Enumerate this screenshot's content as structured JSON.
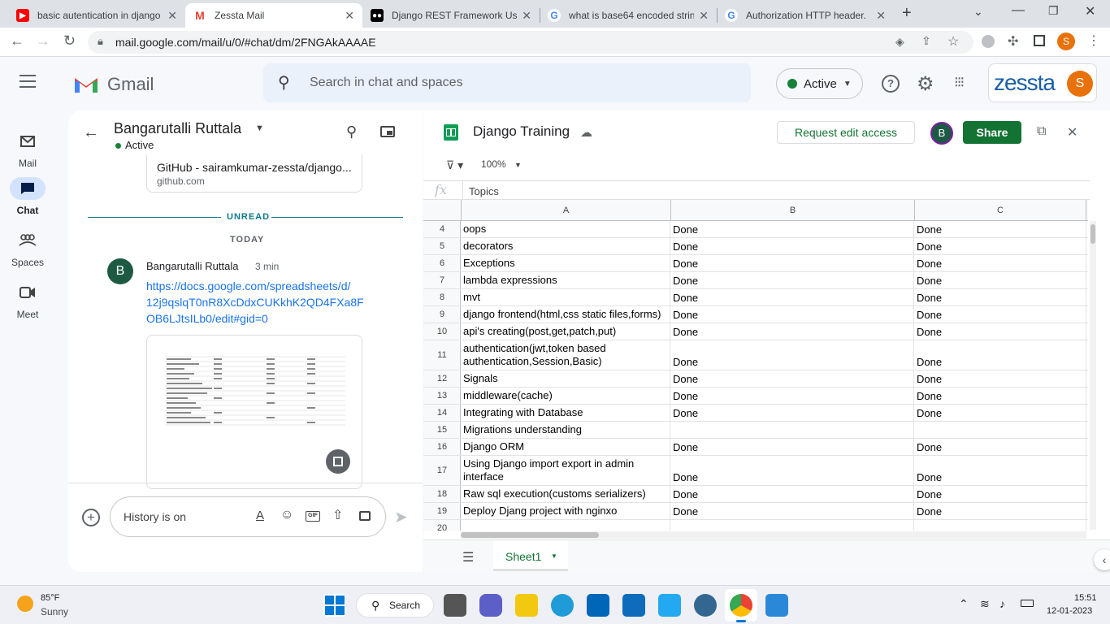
{
  "browser": {
    "tabs": [
      {
        "title": "basic autentication in django",
        "icon": "youtube-icon",
        "color": "#ff0000"
      },
      {
        "title": "Zessta Mail",
        "icon": "gmail-icon",
        "color": "#ea4335"
      },
      {
        "title": "Django REST Framework Use",
        "icon": "medium-icon",
        "color": "#000000"
      },
      {
        "title": "what is base64 encoded strin",
        "icon": "google-icon",
        "color": "#4285f4"
      },
      {
        "title": "Authorization HTTP header.",
        "icon": "google-icon",
        "color": "#4285f4"
      }
    ],
    "url": "mail.google.com/mail/u/0/#chat/dm/2FNGAkAAAAE",
    "profile_initial": "S"
  },
  "gmail": {
    "app_name": "Gmail",
    "search_placeholder": "Search in chat and spaces",
    "status": "Active",
    "brand": "zessta",
    "avatar_initial": "S",
    "nav": [
      {
        "label": "Mail",
        "icon": "mail-icon"
      },
      {
        "label": "Chat",
        "icon": "chat-icon"
      },
      {
        "label": "Spaces",
        "icon": "spaces-icon"
      },
      {
        "label": "Meet",
        "icon": "meet-icon"
      }
    ]
  },
  "chat": {
    "contact_name": "Bangarutalli Ruttala",
    "contact_status": "Active",
    "link_card": {
      "title": "GitHub - sairamkumar-zessta/django...",
      "domain": "github.com"
    },
    "unread_label": "UNREAD",
    "day_label": "TODAY",
    "message": {
      "avatar": "B",
      "sender": "Bangarutalli Ruttala",
      "time": "3 min",
      "link_lines": [
        "https://docs.google.com/spreadsheets/d/",
        "12j9qslqT0nR8XcDdxCUKkhK2QD4FXa8F",
        "OB6LJtsILb0/edit#gid=0"
      ]
    },
    "composer_placeholder": "History is on"
  },
  "sheet": {
    "title": "Django Training",
    "request_label": "Request edit access",
    "share_label": "Share",
    "viewer_initial": "B",
    "zoom": "100%",
    "fx_value": "Topics",
    "columns": [
      "A",
      "B",
      "C"
    ],
    "rows": [
      {
        "num": "4",
        "a": [
          "oops"
        ],
        "b": "Done",
        "c": "Done"
      },
      {
        "num": "5",
        "a": [
          "decorators"
        ],
        "b": "Done",
        "c": "Done"
      },
      {
        "num": "6",
        "a": [
          "Exceptions"
        ],
        "b": "Done",
        "c": "Done"
      },
      {
        "num": "7",
        "a": [
          "lambda expressions"
        ],
        "b": "Done",
        "c": "Done"
      },
      {
        "num": "8",
        "a": [
          "mvt"
        ],
        "b": "Done",
        "c": "Done"
      },
      {
        "num": "9",
        "a": [
          "django frontend(html,css static files,forms)"
        ],
        "b": "Done",
        "c": "Done"
      },
      {
        "num": "10",
        "a": [
          "api's creating(post,get,patch,put)"
        ],
        "b": "Done",
        "c": "Done"
      },
      {
        "num": "11",
        "a": [
          "authentication(jwt,token based",
          "authentication,Session,Basic)"
        ],
        "b": "Done",
        "c": "Done"
      },
      {
        "num": "12",
        "a": [
          "Signals"
        ],
        "b": "Done",
        "c": "Done"
      },
      {
        "num": "13",
        "a": [
          "middleware(cache)"
        ],
        "b": "Done",
        "c": "Done"
      },
      {
        "num": "14",
        "a": [
          "Integrating with Database"
        ],
        "b": "Done",
        "c": "Done"
      },
      {
        "num": "15",
        "a": [
          "Migrations understanding"
        ],
        "b": "",
        "c": ""
      },
      {
        "num": "16",
        "a": [
          "Django ORM"
        ],
        "b": "Done",
        "c": "Done"
      },
      {
        "num": "17",
        "a": [
          "Using Django import export in admin",
          "interface"
        ],
        "b": "Done",
        "c": "Done"
      },
      {
        "num": "18",
        "a": [
          "Raw sql execution(customs serializers)"
        ],
        "b": "Done",
        "c": "Done"
      },
      {
        "num": "19",
        "a": [
          "Deploy Djang project with nginxo"
        ],
        "b": "Done",
        "c": "Done"
      },
      {
        "num": "20",
        "a": [
          ""
        ],
        "b": "",
        "c": ""
      }
    ],
    "sheet_tab": "Sheet1"
  },
  "taskbar": {
    "temp": "85°F",
    "weather": "Sunny",
    "search_label": "Search",
    "time": "15:51",
    "date": "12-01-2023"
  }
}
